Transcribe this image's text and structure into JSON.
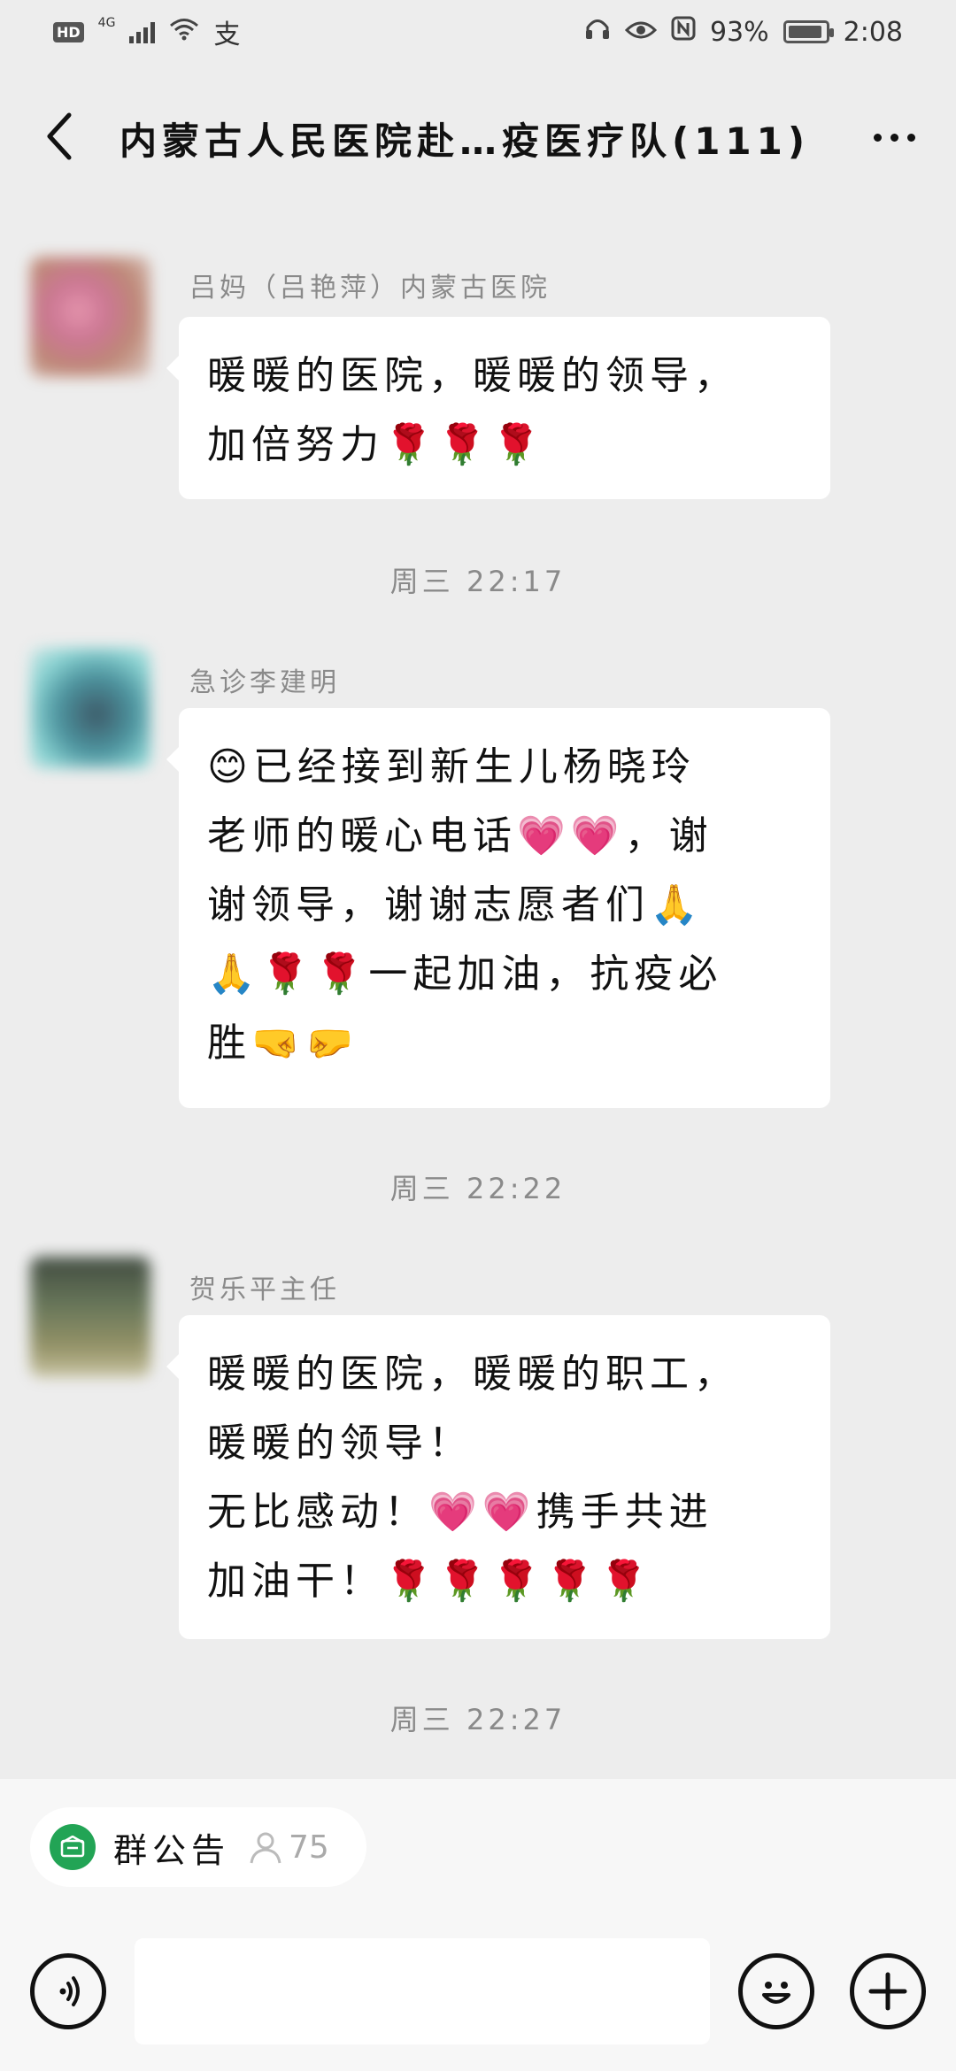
{
  "status_bar": {
    "network_hd": "HD",
    "network_gen": "4G",
    "app_mark": "支",
    "battery_percent": "93%",
    "time": "2:08",
    "battery_level": 0.93
  },
  "header": {
    "title": "内蒙古人民医院赴…疫医疗队(111)"
  },
  "messages": [
    {
      "sender": "吕妈（吕艳萍）内蒙古医院",
      "lines": [
        "暖暖的医院，暖暖的领导，",
        "加倍努力🌹🌹🌹"
      ],
      "time_after": "周三 22:17"
    },
    {
      "sender": "急诊李建明",
      "lines": [
        "😊已经接到新生儿杨晓玲",
        "老师的暖心电话💗💗，谢",
        "谢领导，谢谢志愿者们🙏",
        "🙏🌹🌹一起加油，抗疫必",
        "胜🤜🤛"
      ],
      "time_after": "周三 22:22"
    },
    {
      "sender": "贺乐平主任",
      "lines": [
        "暖暖的医院，暖暖的职工，",
        "暖暖的领导！",
        "无比感动！💗💗携手共进",
        "加油干！🌹🌹🌹🌹🌹"
      ],
      "time_after": "周三 22:27"
    }
  ],
  "announcement": {
    "label": "群公告",
    "member_count": "75"
  },
  "colors": {
    "background": "#ededed",
    "bubble": "#ffffff",
    "accent_green": "#22a455"
  }
}
